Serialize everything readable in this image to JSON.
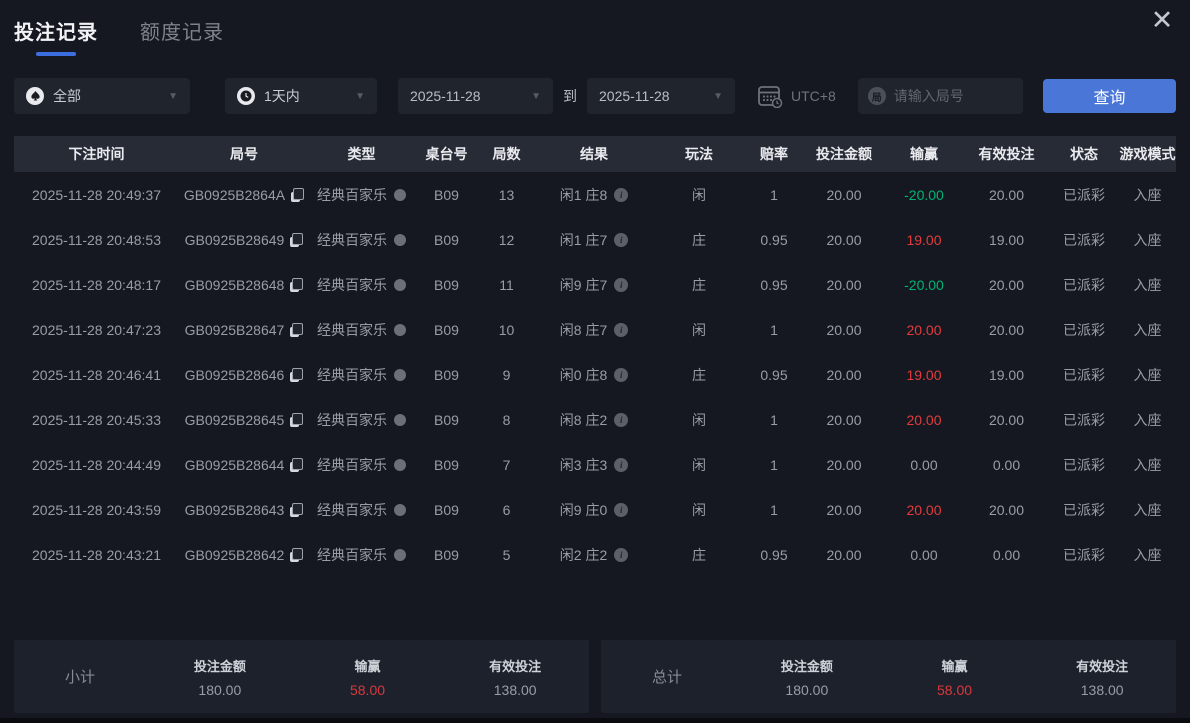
{
  "tabs": [
    {
      "label": "投注记录"
    },
    {
      "label": "额度记录"
    }
  ],
  "close_label": "✕",
  "filters": {
    "game_type": {
      "value": "全部",
      "icon": "spade-icon"
    },
    "time_range": {
      "value": "1天内",
      "icon": "clock-icon"
    },
    "date_from": "2025-11-28",
    "to_label": "到",
    "date_to": "2025-11-28",
    "timezone": "UTC+8",
    "round_input_placeholder": "请输入局号",
    "search_button": "查询"
  },
  "table": {
    "headers": [
      "下注时间",
      "局号",
      "类型",
      "桌台号",
      "局数",
      "结果",
      "玩法",
      "赔率",
      "投注金额",
      "输赢",
      "有效投注",
      "状态",
      "游戏模式"
    ],
    "rows": [
      {
        "time": "2025-11-28 20:49:37",
        "round_id": "GB0925B2864A",
        "type": "经典百家乐",
        "table_no": "B09",
        "round_no": "13",
        "result": "闲1 庄8",
        "play": "闲",
        "odds": "1",
        "bet_amount": "20.00",
        "win_loss": "-20.00",
        "win_sign": "neg",
        "valid_bet": "20.00",
        "status": "已派彩",
        "mode": "入座"
      },
      {
        "time": "2025-11-28 20:48:53",
        "round_id": "GB0925B28649",
        "type": "经典百家乐",
        "table_no": "B09",
        "round_no": "12",
        "result": "闲1 庄7",
        "play": "庄",
        "odds": "0.95",
        "bet_amount": "20.00",
        "win_loss": "19.00",
        "win_sign": "pos",
        "valid_bet": "19.00",
        "status": "已派彩",
        "mode": "入座"
      },
      {
        "time": "2025-11-28 20:48:17",
        "round_id": "GB0925B28648",
        "type": "经典百家乐",
        "table_no": "B09",
        "round_no": "11",
        "result": "闲9 庄7",
        "play": "庄",
        "odds": "0.95",
        "bet_amount": "20.00",
        "win_loss": "-20.00",
        "win_sign": "neg",
        "valid_bet": "20.00",
        "status": "已派彩",
        "mode": "入座"
      },
      {
        "time": "2025-11-28 20:47:23",
        "round_id": "GB0925B28647",
        "type": "经典百家乐",
        "table_no": "B09",
        "round_no": "10",
        "result": "闲8 庄7",
        "play": "闲",
        "odds": "1",
        "bet_amount": "20.00",
        "win_loss": "20.00",
        "win_sign": "pos",
        "valid_bet": "20.00",
        "status": "已派彩",
        "mode": "入座"
      },
      {
        "time": "2025-11-28 20:46:41",
        "round_id": "GB0925B28646",
        "type": "经典百家乐",
        "table_no": "B09",
        "round_no": "9",
        "result": "闲0 庄8",
        "play": "庄",
        "odds": "0.95",
        "bet_amount": "20.00",
        "win_loss": "19.00",
        "win_sign": "pos",
        "valid_bet": "19.00",
        "status": "已派彩",
        "mode": "入座"
      },
      {
        "time": "2025-11-28 20:45:33",
        "round_id": "GB0925B28645",
        "type": "经典百家乐",
        "table_no": "B09",
        "round_no": "8",
        "result": "闲8 庄2",
        "play": "闲",
        "odds": "1",
        "bet_amount": "20.00",
        "win_loss": "20.00",
        "win_sign": "pos",
        "valid_bet": "20.00",
        "status": "已派彩",
        "mode": "入座"
      },
      {
        "time": "2025-11-28 20:44:49",
        "round_id": "GB0925B28644",
        "type": "经典百家乐",
        "table_no": "B09",
        "round_no": "7",
        "result": "闲3 庄3",
        "play": "闲",
        "odds": "1",
        "bet_amount": "20.00",
        "win_loss": "0.00",
        "win_sign": "zero",
        "valid_bet": "0.00",
        "status": "已派彩",
        "mode": "入座"
      },
      {
        "time": "2025-11-28 20:43:59",
        "round_id": "GB0925B28643",
        "type": "经典百家乐",
        "table_no": "B09",
        "round_no": "6",
        "result": "闲9 庄0",
        "play": "闲",
        "odds": "1",
        "bet_amount": "20.00",
        "win_loss": "20.00",
        "win_sign": "pos",
        "valid_bet": "20.00",
        "status": "已派彩",
        "mode": "入座"
      },
      {
        "time": "2025-11-28 20:43:21",
        "round_id": "GB0925B28642",
        "type": "经典百家乐",
        "table_no": "B09",
        "round_no": "5",
        "result": "闲2 庄2",
        "play": "庄",
        "odds": "0.95",
        "bet_amount": "20.00",
        "win_loss": "0.00",
        "win_sign": "zero",
        "valid_bet": "0.00",
        "status": "已派彩",
        "mode": "入座"
      }
    ]
  },
  "summary": {
    "subtotal": {
      "label": "小计",
      "bet_label": "投注金额",
      "bet": "180.00",
      "win_label": "输赢",
      "win": "58.00",
      "valid_label": "有效投注",
      "valid": "138.00"
    },
    "total": {
      "label": "总计",
      "bet_label": "投注金额",
      "bet": "180.00",
      "win_label": "输赢",
      "win": "58.00",
      "valid_label": "有效投注",
      "valid": "138.00"
    }
  },
  "colors": {
    "accent_blue": "#4a76d8",
    "win_positive_red": "#e23b3b",
    "win_negative_green": "#00b473",
    "summary_win_red": "#d9383d"
  }
}
